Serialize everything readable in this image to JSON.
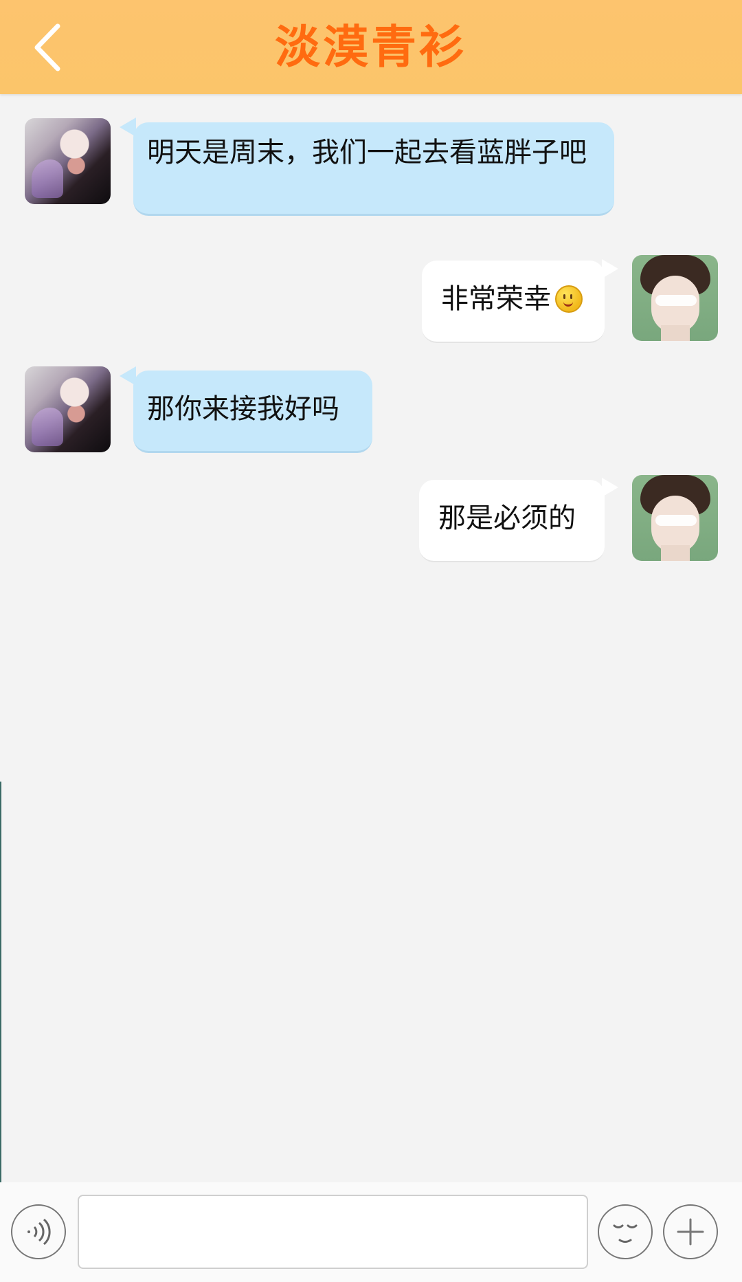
{
  "header": {
    "title": "淡漠青衫"
  },
  "messages": [
    {
      "side": "left",
      "text": "明天是周末，我们一起去看蓝胖子吧"
    },
    {
      "side": "right",
      "text": "非常荣幸"
    },
    {
      "side": "left",
      "text": "那你来接我好吗"
    },
    {
      "side": "right",
      "text": "那是必须的"
    }
  ],
  "input": {
    "value": "",
    "placeholder": ""
  },
  "icons": {
    "back": "chevron-left-icon",
    "voice": "voice-icon",
    "emoji_picker": "smiley-icon",
    "plus": "plus-icon",
    "message_emoji": "smile-emoji-icon"
  },
  "colors": {
    "header_background": "#fdc46e",
    "title_text": "#ff6b10",
    "incoming_bubble": "#c6e8fb",
    "outgoing_bubble": "#ffffff",
    "chat_background": "#f3f3f3"
  }
}
